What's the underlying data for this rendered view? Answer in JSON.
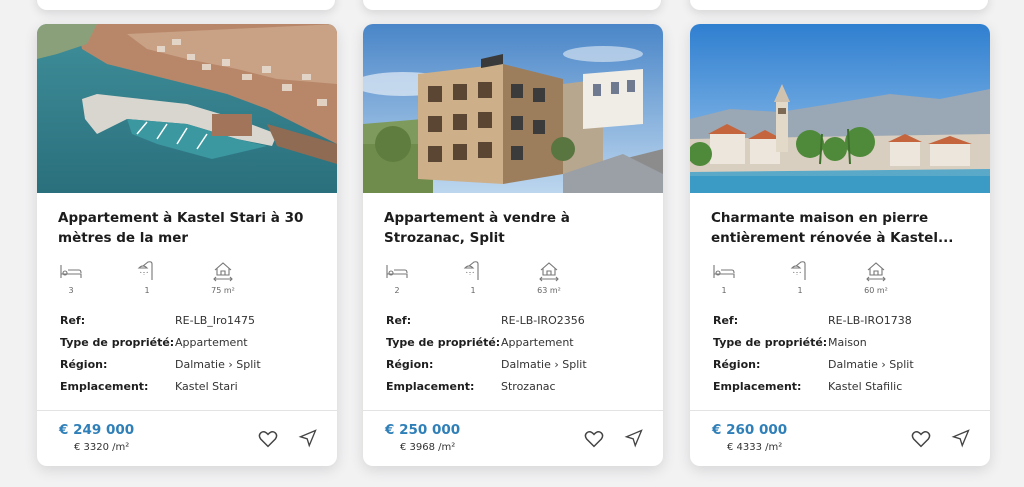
{
  "listings": [
    {
      "title": "Appartement à Kastel Stari à 30 mètres de la mer",
      "bedrooms": "3",
      "bathrooms": "1",
      "area": "75 m²",
      "labels": {
        "ref": "Ref:",
        "type": "Type de propriété:",
        "region": "Région:",
        "location": "Emplacement:"
      },
      "ref": "RE-LB_Iro1475",
      "type": "Appartement",
      "region": "Dalmatie › Split",
      "location": "Kastel Stari",
      "price": "€ 249 000",
      "price_per_m2": "€ 3320 /m²"
    },
    {
      "title": "Appartement à vendre à Strozanac, Split",
      "bedrooms": "2",
      "bathrooms": "1",
      "area": "63 m²",
      "labels": {
        "ref": "Ref:",
        "type": "Type de propriété:",
        "region": "Région:",
        "location": "Emplacement:"
      },
      "ref": "RE-LB-IRO2356",
      "type": "Appartement",
      "region": "Dalmatie › Split",
      "location": "Strozanac",
      "price": "€ 250 000",
      "price_per_m2": "€ 3968 /m²"
    },
    {
      "title": "Charmante maison en pierre entièrement rénovée à Kastel...",
      "bedrooms": "1",
      "bathrooms": "1",
      "area": "60 m²",
      "labels": {
        "ref": "Ref:",
        "type": "Type de propriété:",
        "region": "Région:",
        "location": "Emplacement:"
      },
      "ref": "RE-LB-IRO1738",
      "type": "Maison",
      "region": "Dalmatie › Split",
      "location": "Kastel Stafilic",
      "price": "€ 260 000",
      "price_per_m2": "€ 4333 /m²"
    }
  ],
  "icons": [
    "bed-icon",
    "shower-icon",
    "house-area-icon",
    "heart-icon",
    "navigation-arrow-icon"
  ],
  "colors": {
    "price": "#2f7fb8",
    "background": "#f2f2f3",
    "card": "#ffffff"
  }
}
